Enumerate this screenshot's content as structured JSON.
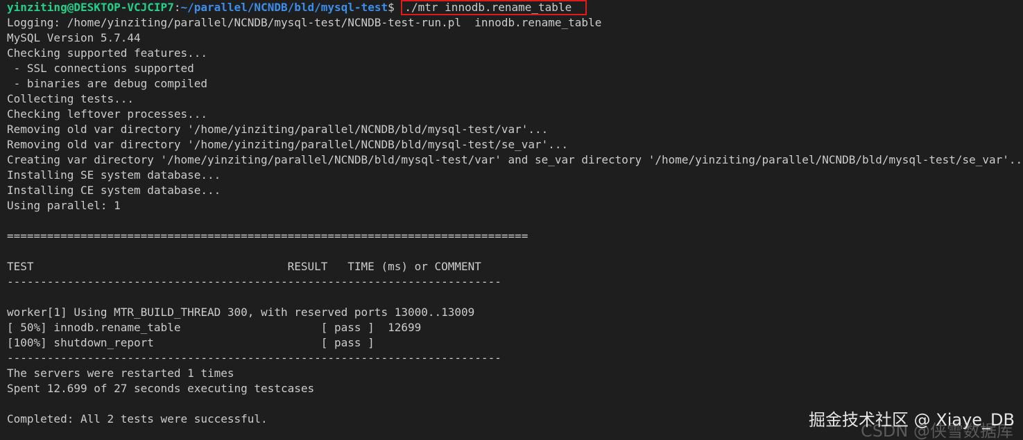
{
  "prompt": {
    "user_host": "yinziting@DESKTOP-VCJCIP7",
    "colon": ":",
    "path": "~/parallel/NCNDB/bld/mysql-test",
    "dollar": "$",
    "command": "./mtr innodb.rename_table"
  },
  "output_lines": [
    "Logging: /home/yinziting/parallel/NCNDB/mysql-test/NCNDB-test-run.pl  innodb.rename_table",
    "MySQL Version 5.7.44",
    "Checking supported features...",
    " - SSL connections supported",
    " - binaries are debug compiled",
    "Collecting tests...",
    "Checking leftover processes...",
    "Removing old var directory '/home/yinziting/parallel/NCNDB/bld/mysql-test/var'...",
    "Removing old var directory '/home/yinziting/parallel/NCNDB/bld/mysql-test/se_var'...",
    "Creating var directory '/home/yinziting/parallel/NCNDB/bld/mysql-test/var' and se_var directory '/home/yinziting/parallel/NCNDB/bld/mysql-test/se_var'...",
    "Installing SE system database...",
    "Installing CE system database...",
    "Using parallel: 1",
    "",
    "==============================================================================",
    "",
    "TEST                                      RESULT   TIME (ms) or COMMENT",
    "--------------------------------------------------------------------------",
    "",
    "worker[1] Using MTR_BUILD_THREAD 300, with reserved ports 13000..13009",
    "[ 50%] innodb.rename_table                     [ pass ]  12699",
    "[100%] shutdown_report                         [ pass ]",
    "--------------------------------------------------------------------------",
    "The servers were restarted 1 times",
    "Spent 12.699 of 27 seconds executing testcases",
    "",
    "Completed: All 2 tests were successful."
  ],
  "watermark": {
    "primary": "掘金技术社区 @ Xiaye_DB",
    "secondary": "CSDN @侠雪数据库"
  }
}
